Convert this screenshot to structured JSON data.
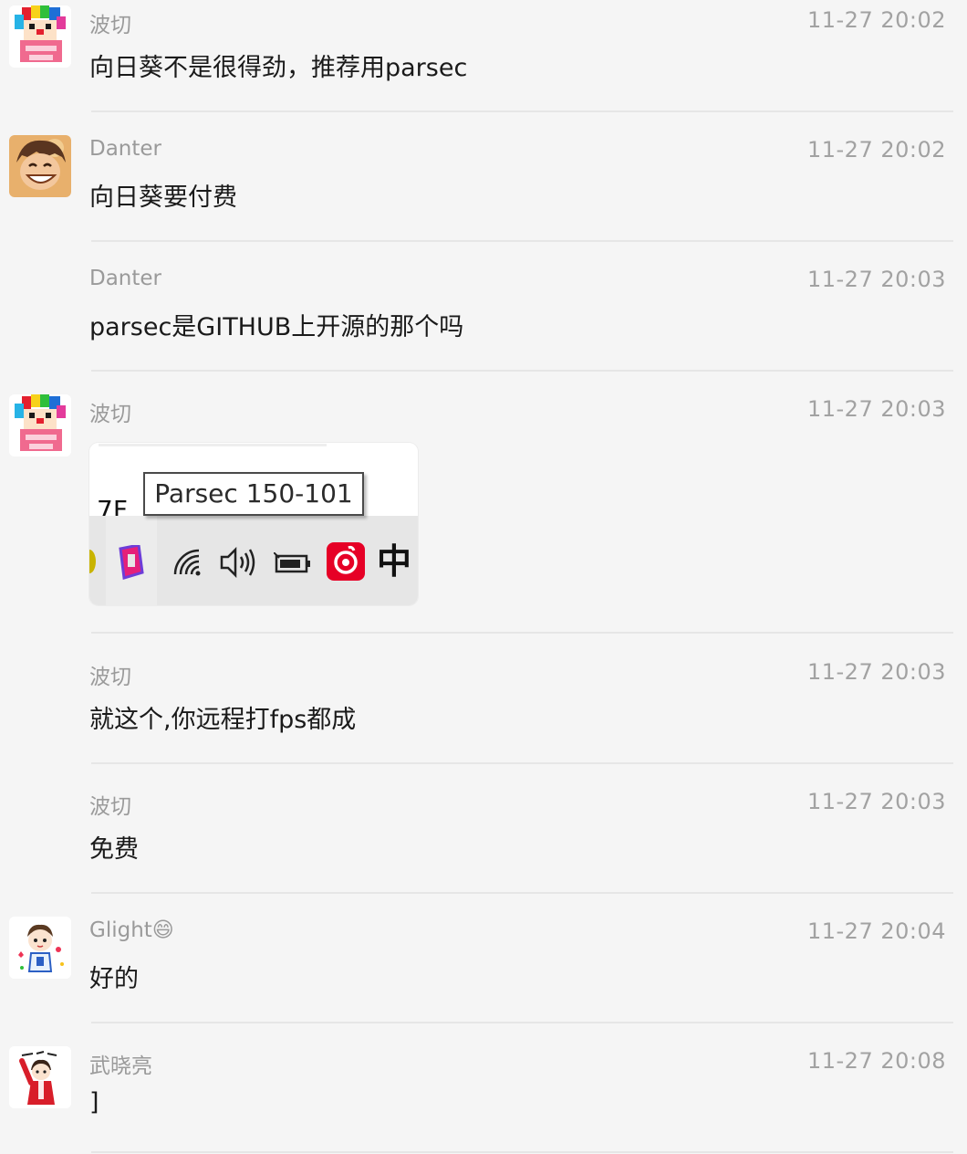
{
  "messages": [
    {
      "sender": "波切",
      "time": "11-27 20:02",
      "text": "向日葵不是很得劲，推荐用parsec",
      "avatar": "clown-avatar"
    },
    {
      "sender": "Danter",
      "time": "11-27 20:02",
      "text": "向日葵要付费",
      "avatar": "anime-boy-avatar"
    },
    {
      "sender": "Danter",
      "time": "11-27 20:03",
      "text": "parsec是GITHUB上开源的那个吗"
    },
    {
      "sender": "波切",
      "time": "11-27 20:03",
      "avatar": "clown-avatar",
      "image": {
        "tooltip": "Parsec 150-101",
        "partial_text": "7F",
        "ime_label": "中",
        "tray_icons": [
          "parsec-icon",
          "wifi-icon",
          "volume-icon",
          "battery-icon",
          "netease-music-icon",
          "ime-icon"
        ]
      }
    },
    {
      "sender": "波切",
      "time": "11-27 20:03",
      "text": "就这个,你远程打fps都成"
    },
    {
      "sender": "波切",
      "time": "11-27 20:03",
      "text": "免费"
    },
    {
      "sender": "Glight😄",
      "time": "11-27 20:04",
      "text": "好的",
      "avatar": "chibi-avatar"
    },
    {
      "sender": "武晓亮",
      "time": "11-27 20:08",
      "text": "]",
      "avatar": "red-figure-avatar"
    }
  ],
  "colors": {
    "background": "#f5f5f5",
    "sender": "#9a9a9a",
    "time": "#a2a2a2",
    "text": "#1a1a1a",
    "divider": "#e6e6e6"
  }
}
